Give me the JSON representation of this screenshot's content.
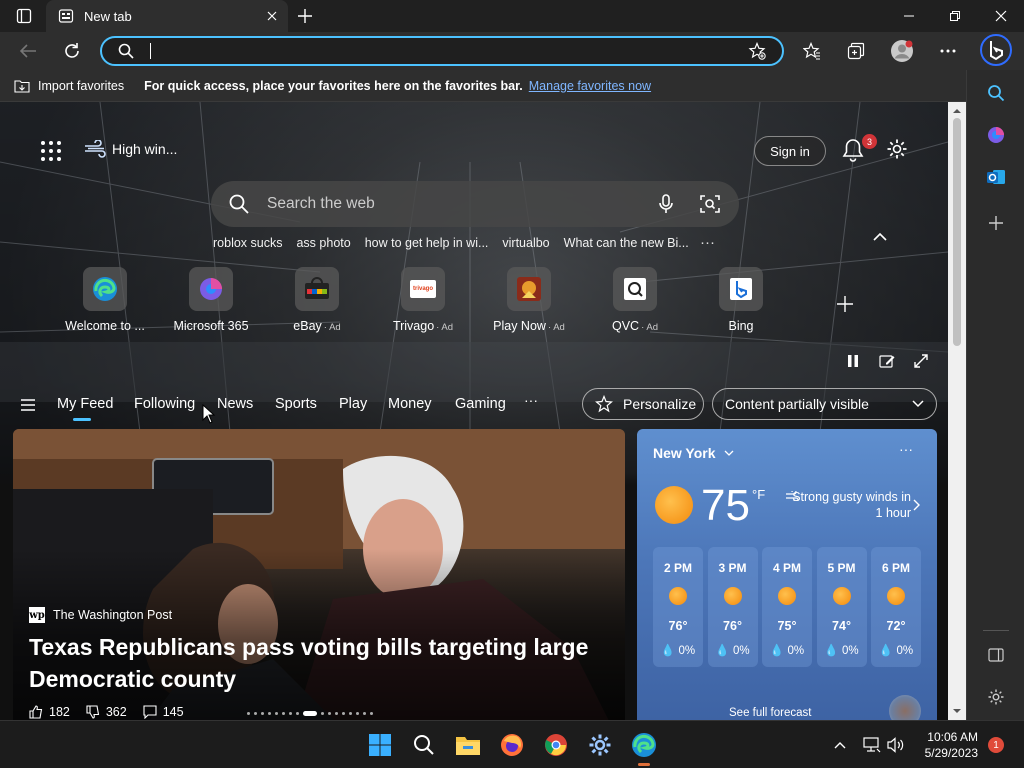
{
  "browser": {
    "tab_title": "New tab",
    "omnibox_value": "",
    "favorites_bar": {
      "import_label": "Import favorites",
      "hint": "For quick access, place your favorites here on the favorites bar.",
      "link": "Manage favorites now"
    }
  },
  "ntp": {
    "weather_mini": "High win...",
    "sign_in": "Sign in",
    "notification_count": "3",
    "search_placeholder": "Search the web",
    "trending": [
      "roblox sucks",
      "ass photo",
      "how to get help in wi...",
      "virtualbo",
      "What can the new Bi..."
    ],
    "trending_more": "···",
    "quick_links": [
      {
        "label": "Welcome to ...",
        "ad": "",
        "icon": "edge-icon"
      },
      {
        "label": "Microsoft 365",
        "ad": "",
        "icon": "microsoft365-icon"
      },
      {
        "label": "eBay",
        "ad": "· Ad",
        "icon": "ebay-icon"
      },
      {
        "label": "Trivago",
        "ad": "· Ad",
        "icon": "trivago-icon"
      },
      {
        "label": "Play Now",
        "ad": "· Ad",
        "icon": "game-icon"
      },
      {
        "label": "QVC",
        "ad": "· Ad",
        "icon": "qvc-icon"
      },
      {
        "label": "Bing",
        "ad": "",
        "icon": "bing-icon"
      }
    ],
    "trivago_logo_text": "trivago",
    "feed_tabs": [
      "My Feed",
      "Following",
      "News",
      "Sports",
      "Play",
      "Money",
      "Gaming"
    ],
    "feed_more": "···",
    "personalize": "Personalize",
    "content_visibility": "Content partially visible"
  },
  "hero": {
    "publisher": "The Washington Post",
    "publisher_logo": "wp",
    "headline": "Texas Republicans pass voting bills targeting large Democratic county",
    "likes": "182",
    "dislikes": "362",
    "comments": "145"
  },
  "weather": {
    "city": "New York",
    "more": "···",
    "temp": "75",
    "unit": "°F",
    "alert": "Strong gusty winds in 1 hour",
    "hourly": [
      {
        "time": "2 PM",
        "temp": "76°",
        "precip": "0%"
      },
      {
        "time": "3 PM",
        "temp": "76°",
        "precip": "0%"
      },
      {
        "time": "4 PM",
        "temp": "75°",
        "precip": "0%"
      },
      {
        "time": "5 PM",
        "temp": "74°",
        "precip": "0%"
      },
      {
        "time": "6 PM",
        "temp": "72°",
        "precip": "0%"
      }
    ],
    "full_forecast": "See full forecast"
  },
  "taskbar": {
    "time": "10:06 AM",
    "date": "5/29/2023",
    "notification_count": "1"
  },
  "colors": {
    "accent": "#4cc2ff",
    "badge_red": "#d13438",
    "link_blue": "#7fb6ff"
  }
}
